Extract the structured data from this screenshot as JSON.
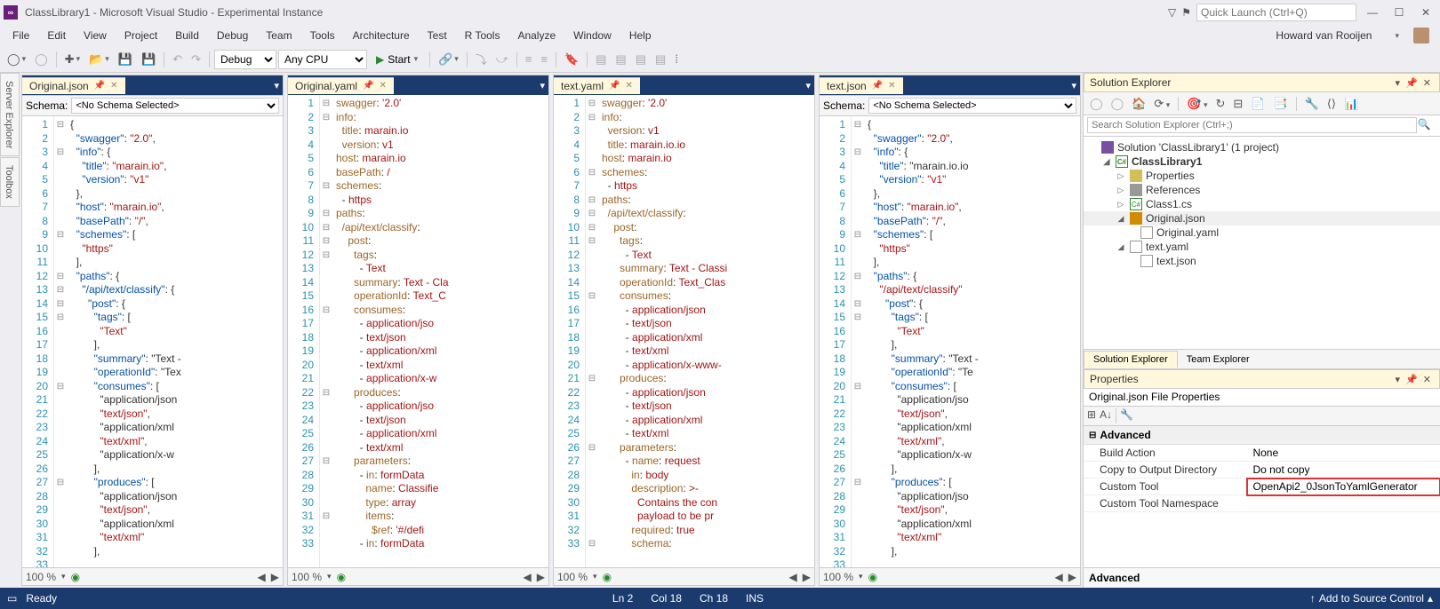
{
  "titlebar": {
    "title": "ClassLibrary1 - Microsoft Visual Studio  - Experimental Instance",
    "quick_launch_placeholder": "Quick Launch (Ctrl+Q)"
  },
  "menubar": {
    "items": [
      "File",
      "Edit",
      "View",
      "Project",
      "Build",
      "Debug",
      "Team",
      "Tools",
      "Architecture",
      "Test",
      "R Tools",
      "Analyze",
      "Window",
      "Help"
    ],
    "user": "Howard van Rooijen"
  },
  "toolbar": {
    "config": "Debug",
    "platform": "Any CPU",
    "start_label": "Start"
  },
  "editors": [
    {
      "tab": "Original.json",
      "has_schema": true,
      "schema": "<No Schema Selected>",
      "lines": 33,
      "type": "json",
      "code": [
        "{",
        "  \"swagger\": \"2.0\",",
        "  \"info\": {",
        "    \"title\": \"marain.io\",",
        "    \"version\": \"v1\"",
        "  },",
        "  \"host\": \"marain.io\",",
        "  \"basePath\": \"/\",",
        "  \"schemes\": [",
        "    \"https\"",
        "  ],",
        "  \"paths\": {",
        "    \"/api/text/classify\": {",
        "      \"post\": {",
        "        \"tags\": [",
        "          \"Text\"",
        "        ],",
        "        \"summary\": \"Text - ",
        "        \"operationId\": \"Tex",
        "        \"consumes\": [",
        "          \"application/json",
        "          \"text/json\",",
        "          \"application/xml",
        "          \"text/xml\",",
        "          \"application/x-w",
        "        ],",
        "        \"produces\": [",
        "          \"application/json",
        "          \"text/json\",",
        "          \"application/xml",
        "          \"text/xml\"",
        "        ],",
        ""
      ]
    },
    {
      "tab": "Original.yaml",
      "has_schema": false,
      "lines": 33,
      "type": "yaml",
      "code": [
        "swagger: '2.0'",
        "info:",
        "  title: marain.io",
        "  version: v1",
        "host: marain.io",
        "basePath: /",
        "schemes:",
        "  - https",
        "paths:",
        "  /api/text/classify:",
        "    post:",
        "      tags:",
        "        - Text",
        "      summary: Text - Cla",
        "      operationId: Text_C",
        "      consumes:",
        "        - application/jso",
        "        - text/json",
        "        - application/xml",
        "        - text/xml",
        "        - application/x-w",
        "      produces:",
        "        - application/jso",
        "        - text/json",
        "        - application/xml",
        "        - text/xml",
        "      parameters:",
        "        - in: formData",
        "          name: Classifie",
        "          type: array",
        "          items:",
        "            $ref: '#/defi",
        "        - in: formData"
      ]
    },
    {
      "tab": "text.yaml",
      "has_schema": false,
      "lines": 33,
      "type": "yaml",
      "code": [
        "swagger: '2.0'",
        "info:",
        "  version: v1",
        "  title: marain.io.io",
        "host: marain.io",
        "schemes:",
        "  - https",
        "paths:",
        "  /api/text/classify:",
        "    post:",
        "      tags:",
        "        - Text",
        "      summary: Text - Classi",
        "      operationId: Text_Clas",
        "      consumes:",
        "        - application/json",
        "        - text/json",
        "        - application/xml",
        "        - text/xml",
        "        - application/x-www-",
        "      produces:",
        "        - application/json",
        "        - text/json",
        "        - application/xml",
        "        - text/xml",
        "      parameters:",
        "        - name: request",
        "          in: body",
        "          description: >-",
        "            Contains the con",
        "            payload to be pr",
        "          required: true",
        "          schema:"
      ]
    },
    {
      "tab": "text.json",
      "has_schema": true,
      "schema": "<No Schema Selected>",
      "lines": 33,
      "type": "json",
      "code": [
        "{",
        "  \"swagger\": \"2.0\",",
        "  \"info\": {",
        "    \"title\": \"marain.io.io",
        "    \"version\": \"v1\"",
        "  },",
        "  \"host\": \"marain.io\",",
        "  \"basePath\": \"/\",",
        "  \"schemes\": [",
        "    \"https\"",
        "  ],",
        "  \"paths\": {",
        "    \"/api/text/classify\"",
        "      \"post\": {",
        "        \"tags\": [",
        "          \"Text\"",
        "        ],",
        "        \"summary\": \"Text -",
        "        \"operationId\": \"Te",
        "        \"consumes\": [",
        "          \"application/jso",
        "          \"text/json\",",
        "          \"application/xml",
        "          \"text/xml\",",
        "          \"application/x-w",
        "        ],",
        "        \"produces\": [",
        "          \"application/jso",
        "          \"text/json\",",
        "          \"application/xml",
        "          \"text/xml\"",
        "        ],",
        ""
      ]
    }
  ],
  "side_tabs": [
    "Server Explorer",
    "Toolbox"
  ],
  "zoom": "100 %",
  "solution_explorer": {
    "title": "Solution Explorer",
    "search_placeholder": "Search Solution Explorer (Ctrl+;)",
    "solution": "Solution 'ClassLibrary1' (1 project)",
    "project": "ClassLibrary1",
    "items": [
      "Properties",
      "References",
      "Class1.cs"
    ],
    "file1": "Original.json",
    "file1_child": "Original.yaml",
    "file2": "text.yaml",
    "file2_child": "text.json",
    "bottom_tabs": [
      "Solution Explorer",
      "Team Explorer"
    ]
  },
  "properties": {
    "title": "Properties",
    "header": "Original.json File Properties",
    "section": "Advanced",
    "rows": [
      {
        "k": "Build Action",
        "v": "None"
      },
      {
        "k": "Copy to Output Directory",
        "v": "Do not copy"
      },
      {
        "k": "Custom Tool",
        "v": "OpenApi2_0JsonToYamlGenerator"
      },
      {
        "k": "Custom Tool Namespace",
        "v": ""
      }
    ],
    "desc": "Advanced"
  },
  "statusbar": {
    "ready": "Ready",
    "ln": "Ln 2",
    "col": "Col 18",
    "ch": "Ch 18",
    "ins": "INS",
    "add_src": "Add to Source Control"
  }
}
